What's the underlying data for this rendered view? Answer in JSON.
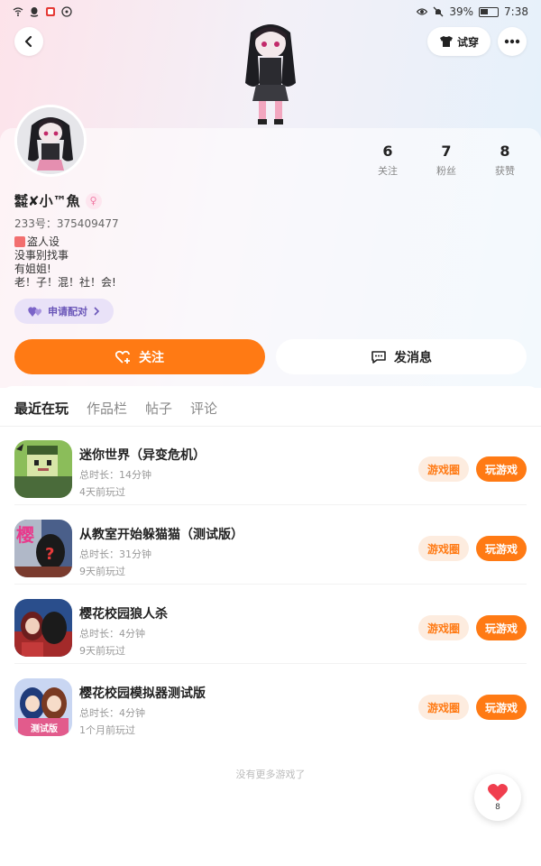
{
  "status_bar": {
    "battery": "39%",
    "time": "7:38"
  },
  "header": {
    "try_on_label": "试穿"
  },
  "profile": {
    "nickname": "㍿✘小™魚",
    "gender_symbol": "♀",
    "uid": "233号：375409477",
    "bio_lines": [
      "盗人设",
      "没事别找事",
      "有姐姐!",
      "老！子！混！社！会!"
    ],
    "match_button": "申请配对",
    "stats": [
      {
        "num": "6",
        "label": "关注"
      },
      {
        "num": "7",
        "label": "粉丝"
      },
      {
        "num": "8",
        "label": "获赞"
      }
    ]
  },
  "actions": {
    "follow": "关注",
    "message": "发消息"
  },
  "tabs": [
    {
      "label": "最近在玩",
      "active": true
    },
    {
      "label": "作品栏",
      "active": false
    },
    {
      "label": "帖子",
      "active": false
    },
    {
      "label": "评论",
      "active": false
    }
  ],
  "games": [
    {
      "title": "迷你世界（异变危机）",
      "duration": "总时长：14分钟",
      "last_played": "4天前玩过",
      "circle_label": "游戏圈",
      "play_label": "玩游戏"
    },
    {
      "title": "从教室开始躲猫猫（测试版）",
      "duration": "总时长：31分钟",
      "last_played": "9天前玩过",
      "circle_label": "游戏圈",
      "play_label": "玩游戏"
    },
    {
      "title": "樱花校园狼人杀",
      "duration": "总时长：4分钟",
      "last_played": "9天前玩过",
      "circle_label": "游戏圈",
      "play_label": "玩游戏"
    },
    {
      "title": "樱花校园模拟器测试版",
      "duration": "总时长：4分钟",
      "last_played": "1个月前玩过",
      "circle_label": "游戏圈",
      "play_label": "玩游戏"
    }
  ],
  "game_icon_texts": {
    "game2_icon_char": "樱",
    "game4_icon_badge": "测试版"
  },
  "footer": {
    "no_more": "没有更多游戏了"
  },
  "like_fab": {
    "count": "8"
  },
  "colors": {
    "accent": "#ff7a14",
    "circle_tag_bg": "#fdecdf",
    "match_bg": "#e9e2f8",
    "heart": "#f03e4e"
  }
}
